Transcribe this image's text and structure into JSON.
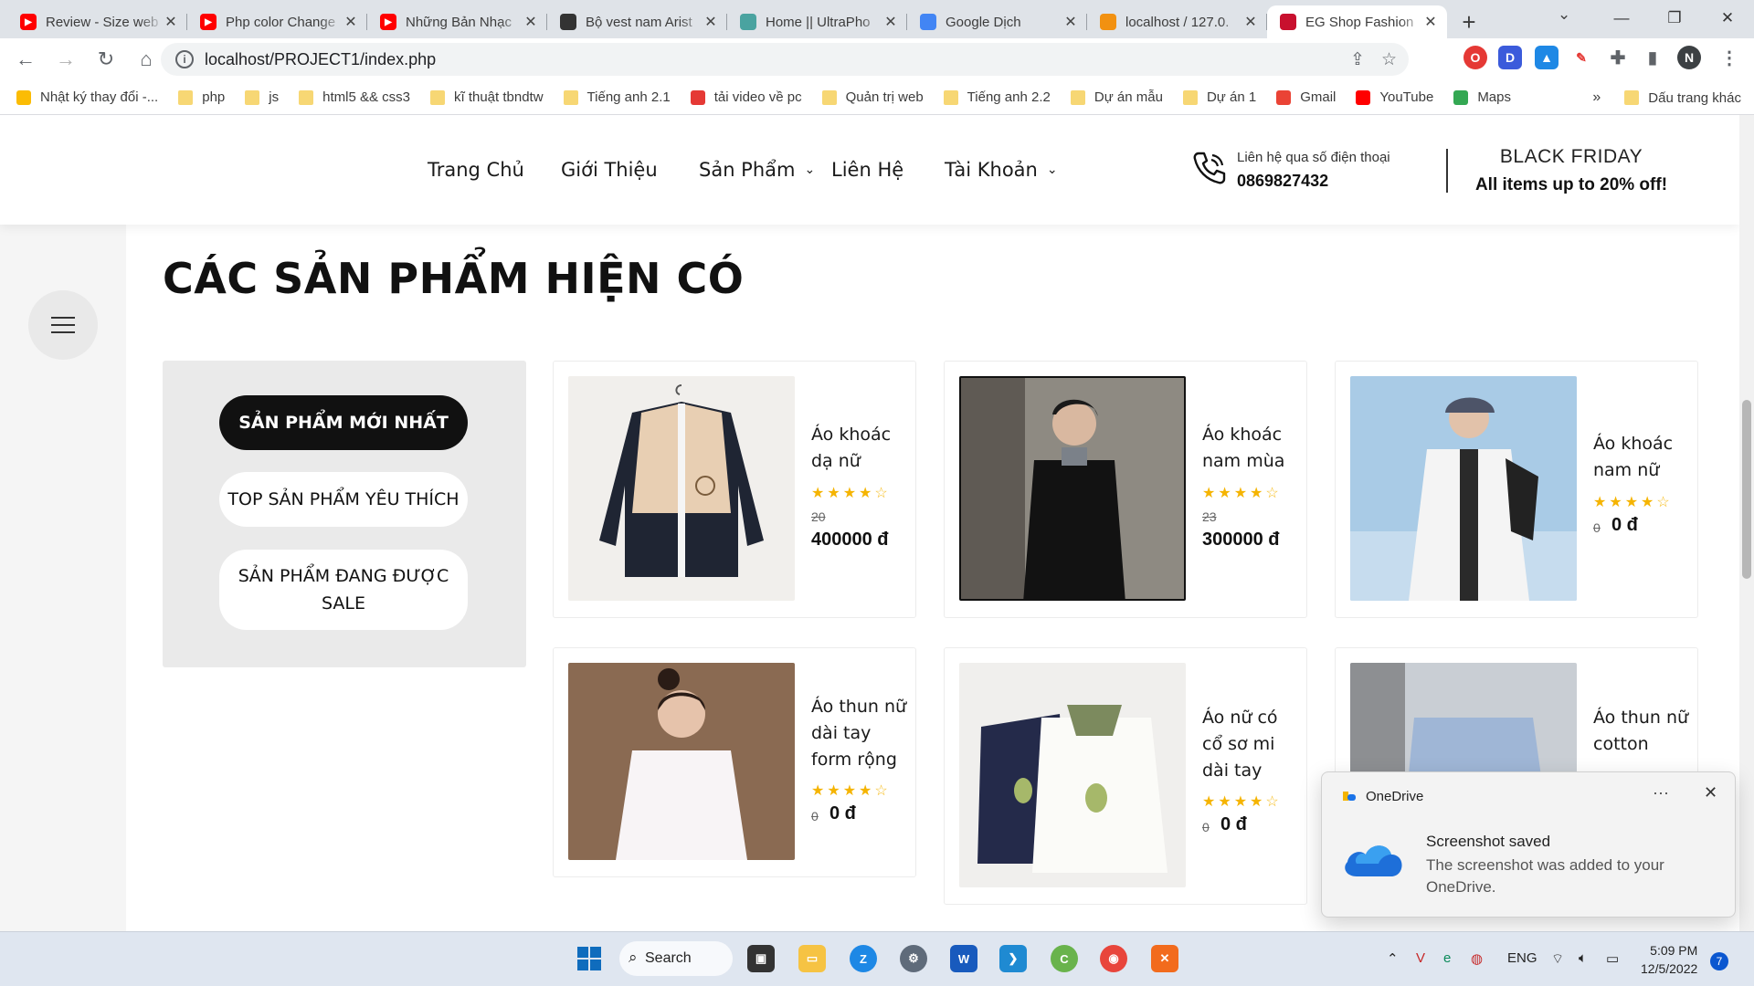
{
  "browser": {
    "tabs": [
      {
        "title": "Review - Size web",
        "icon": "youtube-icon",
        "color": "#ff0000"
      },
      {
        "title": "Php color Change",
        "icon": "youtube-icon",
        "color": "#ff0000"
      },
      {
        "title": "Những Bản Nhạc",
        "icon": "youtube-icon",
        "color": "#ff0000"
      },
      {
        "title": "Bộ vest nam Arist",
        "icon": "wing-icon",
        "color": "#333333"
      },
      {
        "title": "Home || UltraPho",
        "icon": "ultraphone-icon",
        "color": "#4aa3a0"
      },
      {
        "title": "Google Dịch",
        "icon": "google-translate-icon",
        "color": "#4285f4"
      },
      {
        "title": "localhost / 127.0.",
        "icon": "phpmyadmin-icon",
        "color": "#f29111"
      },
      {
        "title": "EG Shop Fashion",
        "icon": "eg-shop-icon",
        "color": "#c8102e"
      }
    ],
    "url": "localhost/PROJECT1/index.php",
    "profile_initial": "N",
    "bookmarks": [
      {
        "label": "Nhật ký thay đổi -...",
        "icon": "google-ads-icon"
      },
      {
        "label": "php",
        "icon": "folder-icon"
      },
      {
        "label": "js",
        "icon": "folder-icon"
      },
      {
        "label": "html5 && css3",
        "icon": "folder-icon"
      },
      {
        "label": "kĩ thuật tbndtw",
        "icon": "folder-icon"
      },
      {
        "label": "Tiếng anh 2.1",
        "icon": "folder-icon"
      },
      {
        "label": "tải video về pc",
        "icon": "4k-icon"
      },
      {
        "label": "Quản trị web",
        "icon": "folder-icon"
      },
      {
        "label": "Tiếng anh 2.2",
        "icon": "folder-icon"
      },
      {
        "label": "Dự án mẫu",
        "icon": "folder-icon"
      },
      {
        "label": "Dự án 1",
        "icon": "folder-icon"
      },
      {
        "label": "Gmail",
        "icon": "gmail-icon"
      },
      {
        "label": "YouTube",
        "icon": "youtube-icon"
      },
      {
        "label": "Maps",
        "icon": "maps-icon"
      }
    ],
    "bookmarks_overflow": "»",
    "other_bookmarks": "Dấu trang khác"
  },
  "site": {
    "nav": {
      "home": "Trang Chủ",
      "about": "Giới Thiệu",
      "products": "Sản Phẩm",
      "contact": "Liên Hệ",
      "account": "Tài Khoản"
    },
    "hotline_label": "Liên hệ qua số điện thoại",
    "hotline_number": "0869827432",
    "promo_title": "BLACK FRIDAY",
    "promo_text": "All items up to 20% off!",
    "section_title": "CÁC SẢN PHẨM HIỆN CÓ",
    "filters": [
      {
        "label": "SẢN PHẨM MỚI NHẤT",
        "active": true
      },
      {
        "label": "TOP SẢN PHẨM YÊU THÍCH",
        "active": false
      },
      {
        "label": "SẢN PHẨM ĐANG ĐƯỢC SALE",
        "active": false
      }
    ],
    "products": [
      {
        "name": "Áo khoác dạ nữ",
        "rating": 4,
        "old_price": "20",
        "price": "400000 đ"
      },
      {
        "name": "Áo khoác nam mùa",
        "rating": 4,
        "old_price": "23",
        "price": "300000 đ"
      },
      {
        "name": "Áo khoác nam nữ",
        "rating": 4,
        "old_price": "0",
        "price": "0 đ"
      },
      {
        "name": "Áo thun nữ dài tay form rộng",
        "rating": 4,
        "old_price": "0",
        "price": "0 đ"
      },
      {
        "name": "Áo nữ có cổ sơ mi dài tay",
        "rating": 4,
        "old_price": "0",
        "price": "0 đ"
      },
      {
        "name": "Áo thun nữ cotton",
        "rating": 4,
        "old_price": "",
        "price": ""
      }
    ]
  },
  "toast": {
    "app": "OneDrive",
    "heading": "Screenshot saved",
    "body": "The screenshot was added to your OneDrive."
  },
  "taskbar": {
    "search_label": "Search",
    "language": "ENG",
    "time": "5:09 PM",
    "date": "12/5/2022",
    "notification_count": "7"
  }
}
